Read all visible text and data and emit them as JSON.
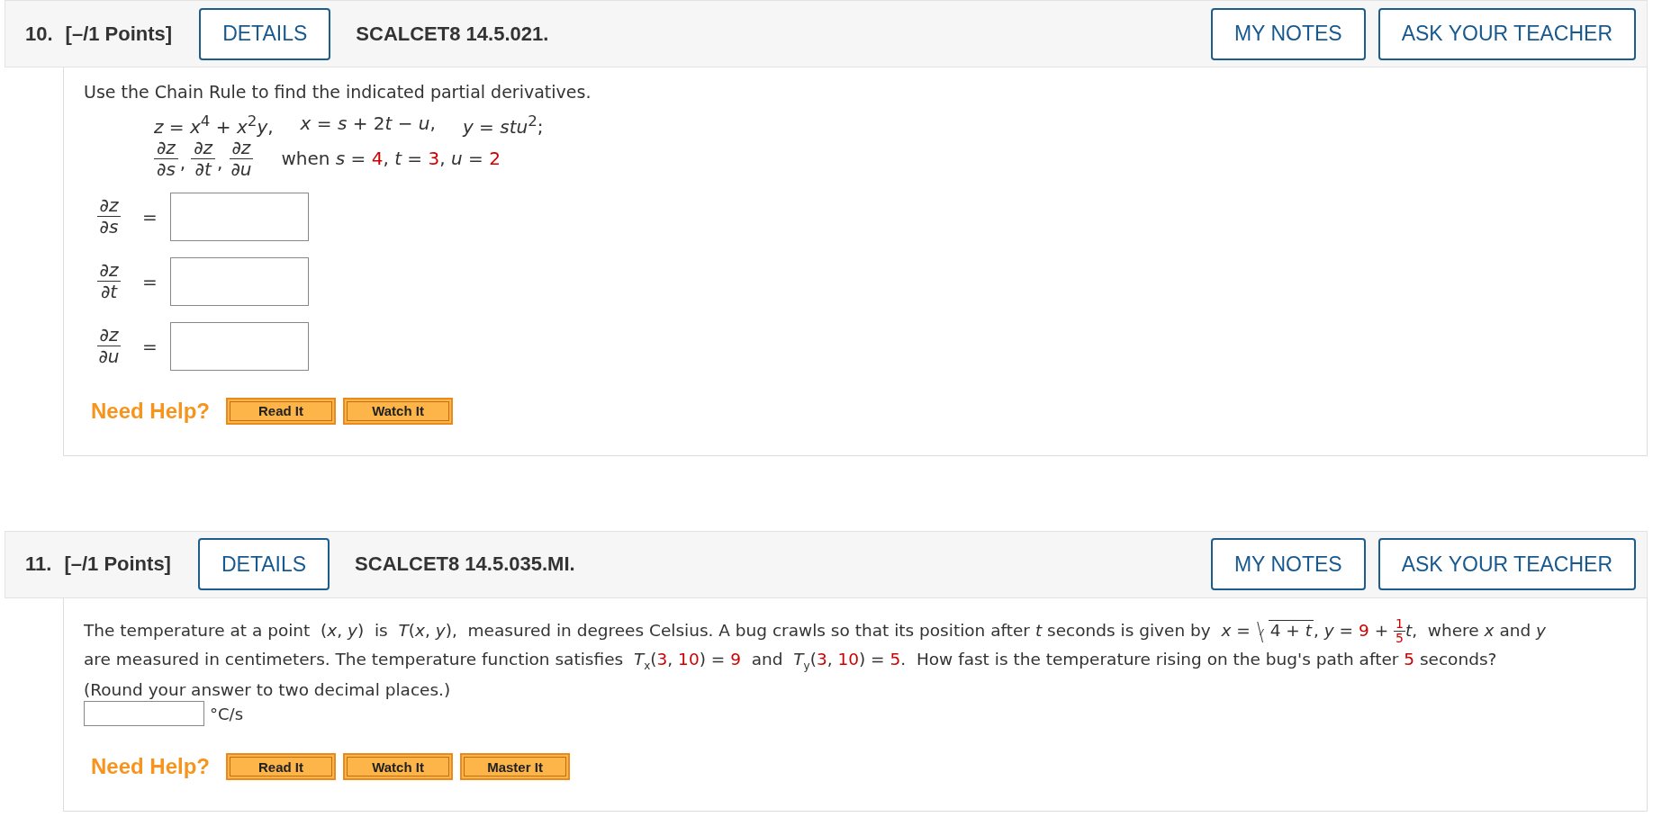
{
  "problems": [
    {
      "number": "10.",
      "points": "[–/1 Points]",
      "details_button": "DETAILS",
      "code": "SCALCET8 14.5.021.",
      "notes_button": "MY NOTES",
      "ask_button": "ASK YOUR TEACHER",
      "body": [
        {
          "kind": "instruction",
          "text": "Use the Chain Rule to find the indicated partial derivatives."
        },
        {
          "kind": "formula",
          "items": [
            [
              {
                "kind": "text",
                "text": "*z* = *x*$^{4}$ + *x*$^{2}$*y*,"
              }
            ],
            [
              {
                "kind": "text",
                "text": "*x* = *s* + 2"
              },
              {
                "kind": "text",
                "text": "*t* − *u*,"
              }
            ],
            [
              {
                "kind": "text",
                "text": "*y* = *stu*$^{2}$;"
              }
            ]
          ]
        },
        {
          "kind": "derivatives",
          "fractions": [
            {
              "numerator": "∂*z*",
              "denominator": "∂*s*",
              "trail": ","
            },
            {
              "numerator": "∂*z*",
              "denominator": "∂*t*",
              "trail": ","
            },
            {
              "numerator": "∂*z*",
              "denominator": "∂*u*"
            }
          ],
          "condition": [
            {
              "kind": "text",
              "text": "when *s* = "
            },
            {
              "kind": "given",
              "text": "4"
            },
            {
              "kind": "text",
              "text": ", *t* = "
            },
            {
              "kind": "given",
              "text": "3"
            },
            {
              "kind": "text",
              "text": ", *u* = "
            },
            {
              "kind": "given",
              "text": "2"
            }
          ]
        },
        {
          "kind": "answers",
          "rows": [
            {
              "numerator": "∂*z*",
              "denominator": "∂*s*",
              "relation": "="
            },
            {
              "numerator": "∂*z*",
              "denominator": "∂*t*",
              "relation": "="
            },
            {
              "numerator": "∂*z*",
              "denominator": "∂*u*",
              "relation": "="
            }
          ]
        }
      ],
      "help": {
        "label": "Need Help?",
        "buttons": [
          "Read It",
          "Watch It"
        ]
      }
    },
    {
      "number": "11.",
      "points": "[–/1 Points]",
      "details_button": "DETAILS",
      "code": "SCALCET8 14.5.035.MI.",
      "notes_button": "MY NOTES",
      "ask_button": "ASK YOUR TEACHER",
      "body": [
        {
          "kind": "paragraph",
          "segments": [
            {
              "kind": "text",
              "text": "The temperature at a point  (*x*, *y*)  is  *T*(*x*, *y*),  measured in degrees Celsius. A bug crawls so that its position after *t* seconds is given by  *x* = "
            },
            {
              "kind": "sqrt",
              "text": "4 + *t*"
            },
            {
              "kind": "text",
              "text": ", *y* = "
            },
            {
              "kind": "given",
              "text": "9"
            },
            {
              "kind": "text",
              "text": " + "
            },
            {
              "kind": "frac",
              "numerator": "1",
              "denominator": "5",
              "given": true
            },
            {
              "kind": "text",
              "text": "*t*,  where *x* and *y* are measured in centimeters. The temperature function satisfies  *T*$_{x}$("
            },
            {
              "kind": "given",
              "text": "3"
            },
            {
              "kind": "text",
              "text": ", "
            },
            {
              "kind": "given",
              "text": "10"
            },
            {
              "kind": "text",
              "text": ") = "
            },
            {
              "kind": "given",
              "text": "9"
            },
            {
              "kind": "text",
              "text": "  and  *T*$_{y}$("
            },
            {
              "kind": "given",
              "text": "3"
            },
            {
              "kind": "text",
              "text": ", "
            },
            {
              "kind": "given",
              "text": "10"
            },
            {
              "kind": "text",
              "text": ") = "
            },
            {
              "kind": "given",
              "text": "5"
            },
            {
              "kind": "text",
              "text": ".  How fast is the temperature rising on the bug's path after "
            },
            {
              "kind": "given",
              "text": "5"
            },
            {
              "kind": "text",
              "text": " seconds? (Round your answer to two decimal places.)"
            }
          ]
        },
        {
          "kind": "unit_answer",
          "unit": "°C/s"
        }
      ],
      "help": {
        "label": "Need Help?",
        "buttons": [
          "Read It",
          "Watch It",
          "Master It"
        ]
      }
    }
  ]
}
